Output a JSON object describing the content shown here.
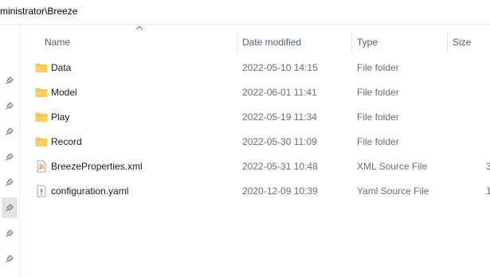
{
  "address": {
    "path": "ministrator\\Breeze"
  },
  "nav_pane": {
    "pins": [
      "pin-icon",
      "pin-icon",
      "pin-icon",
      "pin-icon",
      "pin-icon",
      "pin-icon",
      "pin-icon",
      "pin-icon"
    ],
    "active_index": 5
  },
  "columns": {
    "name": "Name",
    "date_modified": "Date modified",
    "type": "Type",
    "size": "Size",
    "sort_icon": "sort-ascending-icon"
  },
  "files": [
    {
      "name": "Data",
      "date": "2022-05-10 14:15",
      "type": "File folder",
      "size": "",
      "icon": "folder-icon"
    },
    {
      "name": "Model",
      "date": "2022-06-01 11:41",
      "type": "File folder",
      "size": "",
      "icon": "folder-icon"
    },
    {
      "name": "Play",
      "date": "2022-05-19 11:34",
      "type": "File folder",
      "size": "",
      "icon": "folder-icon"
    },
    {
      "name": "Record",
      "date": "2022-05-30 11:09",
      "type": "File folder",
      "size": "",
      "icon": "folder-icon"
    },
    {
      "name": "BreezeProperties.xml",
      "date": "2022-05-31 10:48",
      "type": "XML Source File",
      "size": "3",
      "icon": "xml-file-icon"
    },
    {
      "name": "configuration.yaml",
      "date": "2020-12-09 10:39",
      "type": "Yaml Source File",
      "size": "1",
      "icon": "yaml-file-icon"
    }
  ],
  "colors": {
    "folder": "#f8d05a",
    "header_text": "#4c607a",
    "secondary_text": "#6d6d6d",
    "xml_accent": "#e06b2c"
  }
}
